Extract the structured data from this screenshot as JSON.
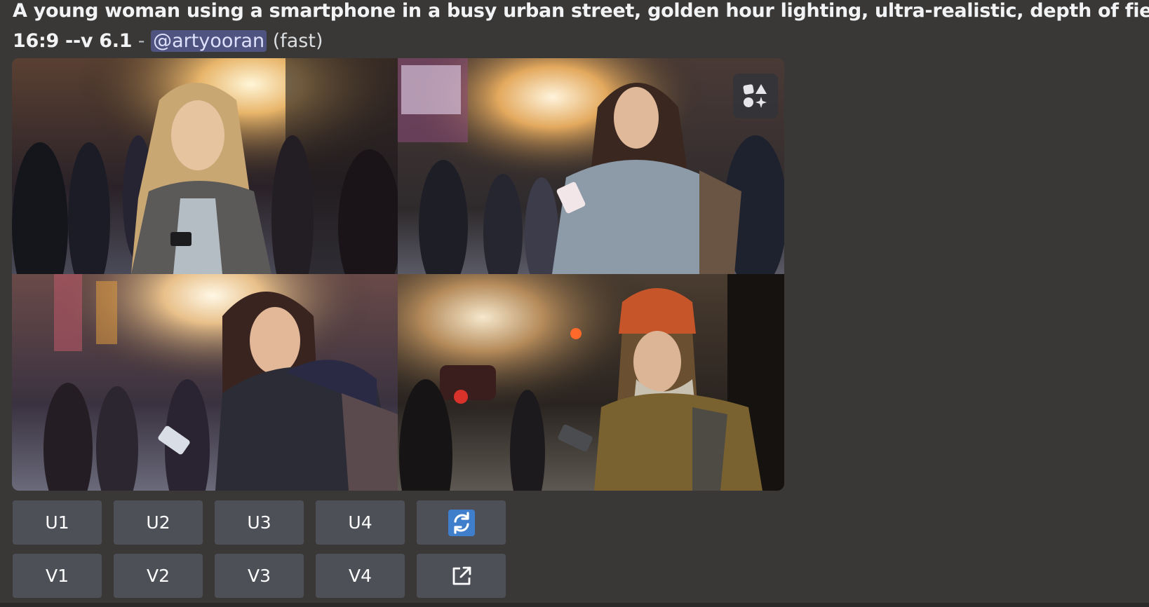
{
  "message": {
    "prompt_line1": "A young woman using a smartphone in a busy urban street, golden hour lighting, ultra-realistic, depth of field, --ar",
    "prompt_line2": "16:9 --v 6.1",
    "separator": " - ",
    "mention": "@artyooran",
    "mode": " (fast)"
  },
  "image_grid": {
    "icon": "image-grid-icon",
    "tiles": [
      "Blonde woman looking at phone on sunlit street",
      "Woman with backpack holding phone in city street",
      "Woman with dark hair bun looking at phone",
      "Woman in orange beanie holding phone"
    ]
  },
  "buttons": {
    "upscale": [
      "U1",
      "U2",
      "U3",
      "U4"
    ],
    "variation": [
      "V1",
      "V2",
      "V3",
      "V4"
    ],
    "reroll_icon": "refresh-icon",
    "open_icon": "external-link-icon"
  },
  "colors": {
    "background": "#3a3836",
    "button": "#4e5058",
    "mention_bg": "#4e5380",
    "reroll_accent": "#3f7ecb"
  }
}
